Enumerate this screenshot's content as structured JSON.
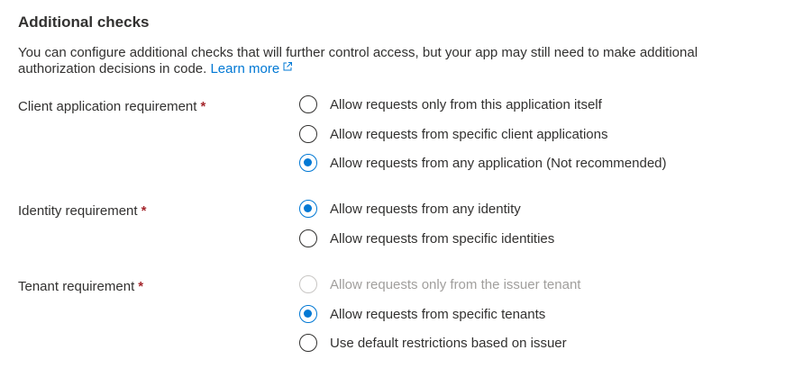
{
  "section": {
    "title": "Additional checks",
    "description": "You can configure additional checks that will further control access, but your app may still need to make additional authorization decisions in code.",
    "learn_more": "Learn more",
    "learn_more_icon": "external-link-icon"
  },
  "required_marker": "*",
  "client_app": {
    "label": "Client application requirement",
    "options": [
      {
        "label": "Allow requests only from this application itself",
        "selected": false,
        "disabled": false
      },
      {
        "label": "Allow requests from specific client applications",
        "selected": false,
        "disabled": false
      },
      {
        "label": "Allow requests from any application (Not recommended)",
        "selected": true,
        "disabled": false
      }
    ]
  },
  "identity": {
    "label": "Identity requirement",
    "options": [
      {
        "label": "Allow requests from any identity",
        "selected": true,
        "disabled": false
      },
      {
        "label": "Allow requests from specific identities",
        "selected": false,
        "disabled": false
      }
    ]
  },
  "tenant": {
    "label": "Tenant requirement",
    "options": [
      {
        "label": "Allow requests only from the issuer tenant",
        "selected": false,
        "disabled": true
      },
      {
        "label": "Allow requests from specific tenants",
        "selected": true,
        "disabled": false
      },
      {
        "label": "Use default restrictions based on issuer",
        "selected": false,
        "disabled": false
      }
    ]
  },
  "colors": {
    "accent": "#0078d4",
    "required": "#a4262c",
    "text": "#323130",
    "disabled_text": "#a19f9d"
  }
}
